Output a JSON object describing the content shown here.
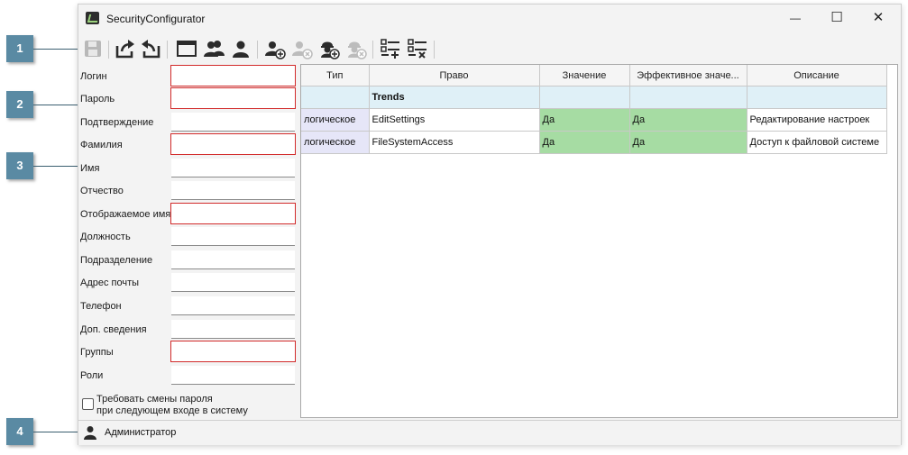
{
  "window": {
    "title": "SecurityConfigurator"
  },
  "title_buttons": {
    "minimize": "—",
    "maximize": "☐",
    "close": "✕"
  },
  "toolbar": {
    "icons": [
      "save-icon",
      "export-icon",
      "import-icon",
      "window-icon",
      "users-icon",
      "user-icon",
      "add-user-icon",
      "remove-user-icon",
      "add-role-icon",
      "remove-role-icon",
      "add-rights-icon",
      "remove-rights-icon"
    ]
  },
  "form": {
    "fields": [
      {
        "label": "Логин",
        "value": "",
        "error": true
      },
      {
        "label": "Пароль",
        "value": "",
        "error": true
      },
      {
        "label": "Подтверждение",
        "value": "",
        "error": false
      },
      {
        "label": "Фамилия",
        "value": "",
        "error": true
      },
      {
        "label": "Имя",
        "value": "",
        "error": false
      },
      {
        "label": "Отчество",
        "value": "",
        "error": false
      },
      {
        "label": "Отображаемое имя",
        "value": "",
        "error": true
      },
      {
        "label": "Должность",
        "value": "",
        "error": false
      },
      {
        "label": "Подразделение",
        "value": "",
        "error": false
      },
      {
        "label": "Адрес почты",
        "value": "",
        "error": false
      },
      {
        "label": "Телефон",
        "value": "",
        "error": false
      },
      {
        "label": "Доп. сведения",
        "value": "",
        "error": false
      },
      {
        "label": "Группы",
        "value": "",
        "error": true
      },
      {
        "label": "Роли",
        "value": "",
        "error": false
      }
    ],
    "require_change_line1": "Требовать смены пароля",
    "require_change_line2": "при следующем входе в систему",
    "require_change_checked": false
  },
  "grid": {
    "columns": [
      "Тип",
      "Право",
      "Значение",
      "Эффективное значе...",
      "Описание"
    ],
    "group": "Trends",
    "rows": [
      {
        "type": "логическое",
        "right": "EditSettings",
        "value": "Да",
        "effective": "Да",
        "description": "Редактирование настроек"
      },
      {
        "type": "логическое",
        "right": "FileSystemAccess",
        "value": "Да",
        "effective": "Да",
        "description": "Доступ к файловой системе"
      }
    ]
  },
  "status": {
    "user": "Администратор"
  },
  "callouts": [
    "1",
    "2",
    "3",
    "4"
  ],
  "colors": {
    "error_border": "#d22a2a",
    "group_row": "#dff0f7",
    "value_green": "#a6dca3",
    "type_cell": "#e6e6f8",
    "callout": "#5a8aa3"
  }
}
